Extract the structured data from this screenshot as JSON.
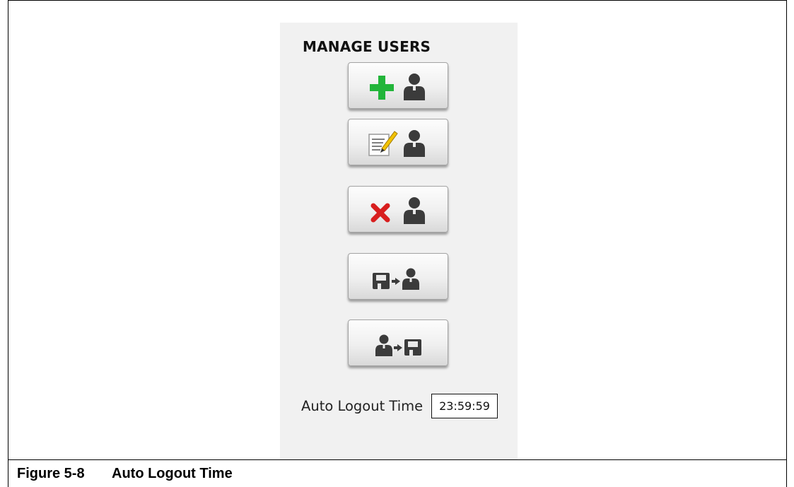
{
  "panel": {
    "title": "MANAGE USERS",
    "buttons": [
      {
        "name": "add-user-button",
        "icons": [
          "plus-icon",
          "user-icon"
        ],
        "accent": "#22b53a"
      },
      {
        "name": "edit-user-button",
        "icons": [
          "edit-note-icon",
          "user-icon"
        ],
        "accent": "#f2c200"
      },
      {
        "name": "delete-user-button",
        "icons": [
          "red-x-icon",
          "user-icon"
        ],
        "accent": "#d81e1e"
      },
      {
        "name": "import-users-button",
        "icons": [
          "floppy-disk-icon",
          "arrow-right-icon",
          "user-icon"
        ]
      },
      {
        "name": "export-users-button",
        "icons": [
          "user-icon",
          "arrow-right-icon",
          "floppy-disk-icon"
        ]
      }
    ],
    "auto_logout": {
      "label": "Auto Logout Time",
      "value": "23:59:59"
    }
  },
  "caption": {
    "number": "Figure 5-8",
    "title": "Auto Logout Time"
  },
  "colors": {
    "icon_dark": "#3b3b3b",
    "panel_bg": "#f1f1f1"
  }
}
